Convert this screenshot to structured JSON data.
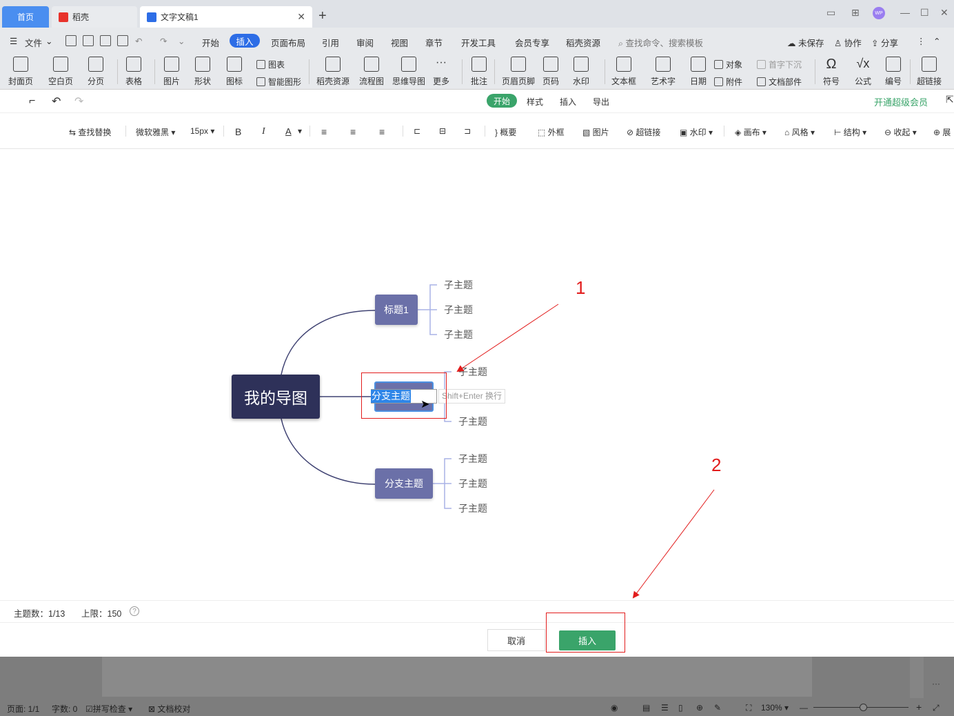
{
  "tabs": {
    "home": "首页",
    "daoke": "稻壳",
    "doc": "文字文稿1"
  },
  "menu": {
    "file": "文件",
    "items": [
      "开始",
      "插入",
      "页面布局",
      "引用",
      "审阅",
      "视图",
      "章节",
      "开发工具",
      "会员专享",
      "稻壳资源"
    ],
    "search_placeholder": "查找命令、搜索模板",
    "unsaved": "未保存",
    "collab": "协作",
    "share": "分享"
  },
  "ribbon": {
    "cover": "封面页",
    "blank": "空白页",
    "pagebreak": "分页",
    "table": "表格",
    "picture": "图片",
    "shape": "形状",
    "icon": "图标",
    "chart": "图表",
    "smartart": "智能图形",
    "daoke_res": "稻壳资源",
    "flowchart": "流程图",
    "mindmap": "思维导图",
    "more": "更多",
    "comment": "批注",
    "headerfooter": "页眉页脚",
    "pagenum": "页码",
    "watermark": "水印",
    "textbox": "文本框",
    "wordart": "艺术字",
    "date": "日期",
    "object": "对象",
    "attachment": "附件",
    "dropcap": "首字下沉",
    "docpart": "文档部件",
    "symbol": "符号",
    "formula": "公式",
    "numbering": "编号",
    "hyperlink": "超链接"
  },
  "dialog": {
    "tabs": {
      "start": "开始",
      "style": "样式",
      "insert": "插入",
      "export": "导出"
    },
    "vip": "开通超级会员",
    "format": {
      "find_replace": "查找替换",
      "font": "微软雅黑",
      "size": "15px",
      "bold": "B",
      "italic": "I",
      "fontcolor": "A",
      "summary": "概要",
      "border": "外框",
      "image": "图片",
      "hyperlink": "超链接",
      "watermark": "水印",
      "canvas": "画布",
      "style": "风格",
      "structure": "结构",
      "collapse": "收起",
      "expand": "展"
    },
    "mindmap": {
      "root": "我的导图",
      "branches": [
        {
          "label": "标题1",
          "children": [
            "子主题",
            "子主题",
            "子主题"
          ]
        },
        {
          "label": "分支主题",
          "children": [
            "子主题",
            "子主题"
          ]
        },
        {
          "label": "分支主题",
          "children": [
            "子主题",
            "子主题",
            "子主题"
          ]
        }
      ],
      "editing_text": "分支主题",
      "edit_hint": "Shift+Enter 换行"
    },
    "annotations": {
      "one": "1",
      "two": "2"
    },
    "status": {
      "topic_count": "主题数：1/13",
      "limit": "上限：150",
      "help": "?"
    },
    "buttons": {
      "cancel": "取消",
      "insert": "插入"
    }
  },
  "statusbar": {
    "page": "页面: 1/1",
    "words": "字数: 0",
    "spell": "拼写检查",
    "proof": "文档校对",
    "zoom": "130%"
  },
  "colors": {
    "accent_blue": "#2d6de6",
    "accent_green": "#3aa46a",
    "annotation_red": "#e21c1c",
    "root_node": "#2e3159",
    "branch_node": "#6b70a8"
  }
}
